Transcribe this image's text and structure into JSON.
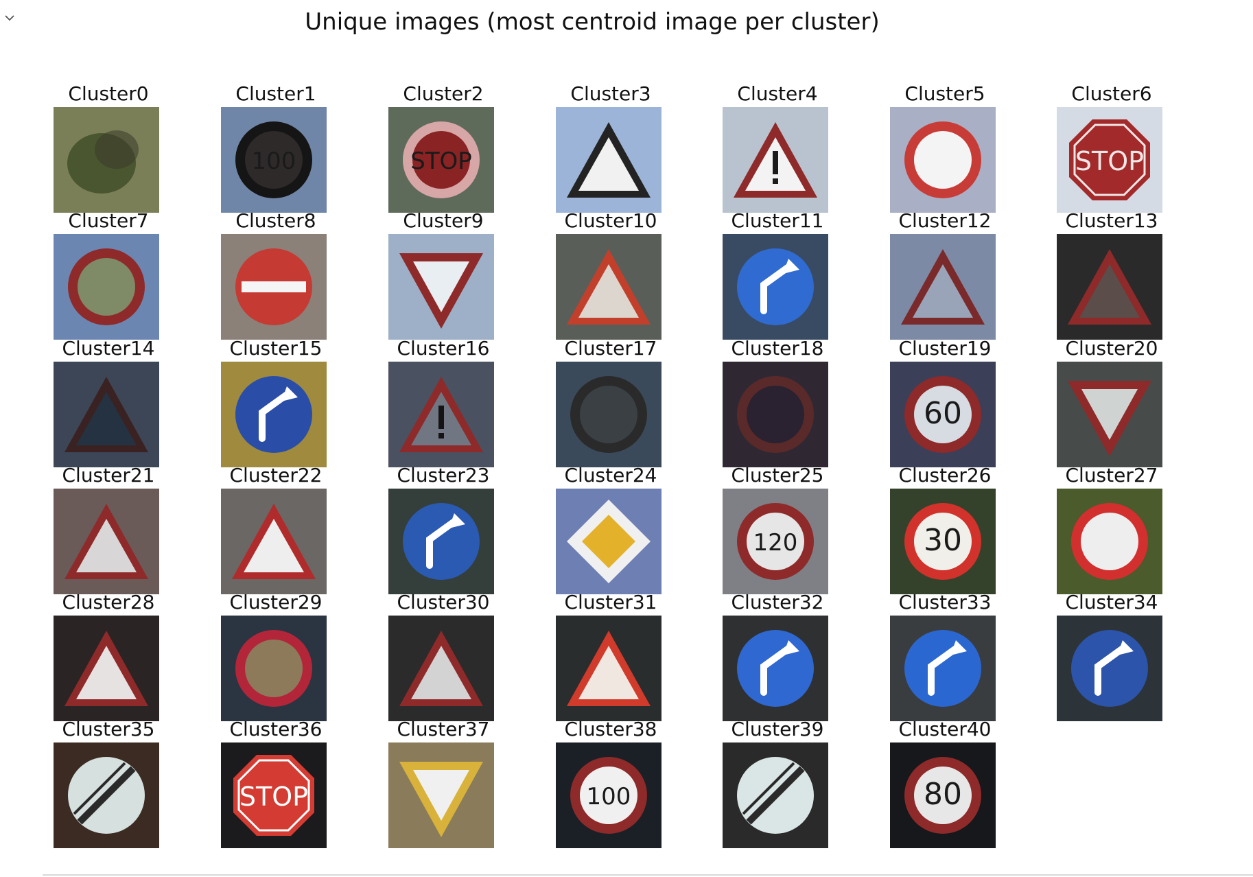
{
  "output_toggle_icon": "chevron-down-icon",
  "figure": {
    "title": "Unique images (most centroid image per cluster)"
  },
  "clusters": [
    {
      "label": "Cluster0",
      "sign": "blur",
      "bg": "#7a7f57",
      "fg": "#4a5630",
      "ink": "#3a3a2a"
    },
    {
      "label": "Cluster1",
      "sign": "circle-text",
      "text": "100",
      "bg": "#6f86a8",
      "fg": "#2e2a2a",
      "ink": "#151515"
    },
    {
      "label": "Cluster2",
      "sign": "circle-text",
      "text": "STOP",
      "bg": "#5e6b5a",
      "fg": "#8a2323",
      "ink": "#d7a6a6"
    },
    {
      "label": "Cluster3",
      "sign": "triangle",
      "bg": "#9bb4d7",
      "fg": "#f1f1f1",
      "ink": "#232323"
    },
    {
      "label": "Cluster4",
      "sign": "triangle-excl",
      "bg": "#b9c3cf",
      "fg": "#f3f3f3",
      "ink": "#1b1b1b"
    },
    {
      "label": "Cluster5",
      "sign": "ring",
      "bg": "#a9afc4",
      "fg": "#f4f4f4",
      "ink": "#c83c38"
    },
    {
      "label": "Cluster6",
      "sign": "octagon",
      "text": "STOP",
      "bg": "#d5dbe4",
      "fg": "#a22a2a",
      "ink": "#f2e7e7"
    },
    {
      "label": "Cluster7",
      "sign": "ring",
      "bg": "#6c86b2",
      "fg": "#7f8a67",
      "ink": "#8e2a2a"
    },
    {
      "label": "Cluster8",
      "sign": "no-entry",
      "bg": "#8b8178",
      "fg": "#c63a34",
      "ink": "#f5f5f5"
    },
    {
      "label": "Cluster9",
      "sign": "yield",
      "bg": "#9db0c7",
      "fg": "#e9eef2",
      "ink": "#1f1f1f"
    },
    {
      "label": "Cluster10",
      "sign": "triangle",
      "bg": "#5a5e58",
      "fg": "#ddd6cf",
      "ink": "#c2402b"
    },
    {
      "label": "Cluster11",
      "sign": "blue-circle",
      "bg": "#394b63",
      "fg": "#2f6bd0",
      "ink": "#ffffff"
    },
    {
      "label": "Cluster12",
      "sign": "triangle",
      "bg": "#7d8aa5",
      "fg": "#9aa4b8",
      "ink": "#7a2a2a"
    },
    {
      "label": "Cluster13",
      "sign": "triangle",
      "bg": "#2b2a2a",
      "fg": "#5a4d4a",
      "ink": "#8e2a2a"
    },
    {
      "label": "Cluster14",
      "sign": "triangle",
      "bg": "#3c4656",
      "fg": "#243242",
      "ink": "#3b2222"
    },
    {
      "label": "Cluster15",
      "sign": "blue-circle",
      "bg": "#9f8a3e",
      "fg": "#2a4ea8",
      "ink": "#ffffff"
    },
    {
      "label": "Cluster16",
      "sign": "triangle-excl",
      "bg": "#4a5160",
      "fg": "#707783",
      "ink": "#141414"
    },
    {
      "label": "Cluster17",
      "sign": "ring",
      "bg": "#3a4a5a",
      "fg": "#3a4044",
      "ink": "#2a2a2a"
    },
    {
      "label": "Cluster18",
      "sign": "ring",
      "bg": "#2f2833",
      "fg": "#2a2230",
      "ink": "#5a2a2a"
    },
    {
      "label": "Cluster19",
      "sign": "circle-text",
      "text": "60",
      "bg": "#3c3f58",
      "fg": "#d7dbe2",
      "ink": "#8e2a2a"
    },
    {
      "label": "Cluster20",
      "sign": "yield",
      "bg": "#474c4b",
      "fg": "#cfd4d2",
      "ink": "#2a2a2a"
    },
    {
      "label": "Cluster21",
      "sign": "triangle",
      "bg": "#6a5a58",
      "fg": "#d8d6d6",
      "ink": "#8e2a2a"
    },
    {
      "label": "Cluster22",
      "sign": "triangle",
      "bg": "#6b6764",
      "fg": "#eeeeee",
      "ink": "#b02b2b"
    },
    {
      "label": "Cluster23",
      "sign": "blue-circle",
      "bg": "#343f3b",
      "fg": "#2b5ab3",
      "ink": "#ffffff"
    },
    {
      "label": "Cluster24",
      "sign": "diamond",
      "bg": "#6e7fb3",
      "fg": "#f0f0f0",
      "ink": "#e3b12a"
    },
    {
      "label": "Cluster25",
      "sign": "circle-text",
      "text": "120",
      "bg": "#7f7f86",
      "fg": "#e6e6e6",
      "ink": "#8e2a2a"
    },
    {
      "label": "Cluster26",
      "sign": "circle-text",
      "text": "30",
      "bg": "#35422b",
      "fg": "#f0efe9",
      "ink": "#d1322b"
    },
    {
      "label": "Cluster27",
      "sign": "ring",
      "bg": "#4b5b2b",
      "fg": "#eeeeee",
      "ink": "#d22f2f"
    },
    {
      "label": "Cluster28",
      "sign": "triangle",
      "bg": "#2a2424",
      "fg": "#e7e2e2",
      "ink": "#8e2a2a"
    },
    {
      "label": "Cluster29",
      "sign": "ring",
      "bg": "#2b3441",
      "fg": "#8c7a5b",
      "ink": "#b3263a"
    },
    {
      "label": "Cluster30",
      "sign": "triangle",
      "bg": "#2b2b2b",
      "fg": "#d3d3d3",
      "ink": "#8e2a2a"
    },
    {
      "label": "Cluster31",
      "sign": "triangle",
      "bg": "#2a2d2e",
      "fg": "#f1e7e1",
      "ink": "#d03b2b"
    },
    {
      "label": "Cluster32",
      "sign": "blue-circle",
      "bg": "#2f3032",
      "fg": "#2e68d0",
      "ink": "#ffffff"
    },
    {
      "label": "Cluster33",
      "sign": "blue-circle",
      "bg": "#3a3d40",
      "fg": "#2b67d1",
      "ink": "#ffffff"
    },
    {
      "label": "Cluster34",
      "sign": "blue-circle",
      "bg": "#2d3439",
      "fg": "#2b54aa",
      "ink": "#ffffff"
    },
    {
      "label": "Cluster35",
      "sign": "end-limit",
      "bg": "#3b2b22",
      "fg": "#d6e0de",
      "ink": "#2a2a2a"
    },
    {
      "label": "Cluster36",
      "sign": "octagon",
      "text": "STOP",
      "bg": "#1b1b1d",
      "fg": "#d43b32",
      "ink": "#ffffff"
    },
    {
      "label": "Cluster37",
      "sign": "yield",
      "bg": "#8a7b5a",
      "fg": "#f0f0f0",
      "ink": "#d8b23b"
    },
    {
      "label": "Cluster38",
      "sign": "circle-text",
      "text": "100",
      "bg": "#1a2026",
      "fg": "#f0f0f0",
      "ink": "#8e2a2a"
    },
    {
      "label": "Cluster39",
      "sign": "end-limit",
      "bg": "#2a2a2a",
      "fg": "#d9e6e5",
      "ink": "#2a2a2a"
    },
    {
      "label": "Cluster40",
      "sign": "circle-text",
      "text": "80",
      "bg": "#16181b",
      "fg": "#e7e7e7",
      "ink": "#8e2a2a"
    }
  ]
}
